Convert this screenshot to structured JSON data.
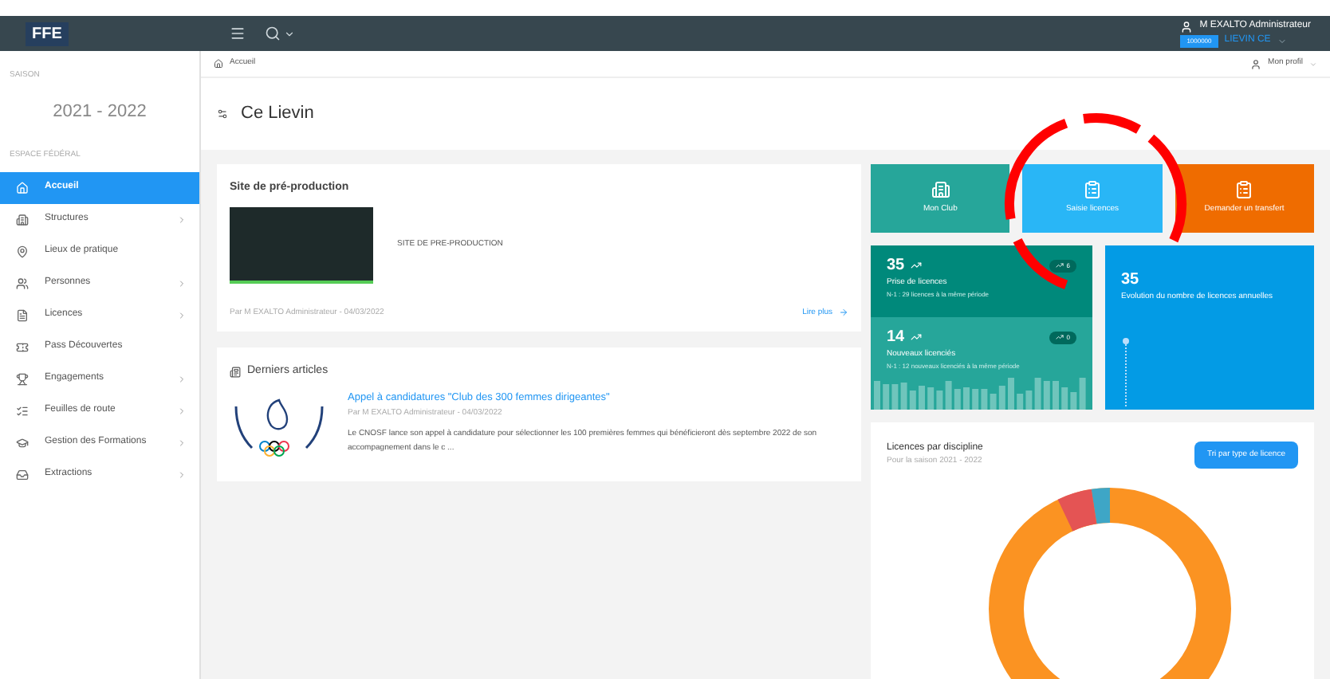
{
  "header": {
    "logo": "FFE",
    "user": "M EXALTO Administrateur",
    "badge": "1000000",
    "club": "LIEVIN CE"
  },
  "sidebar": {
    "season_label": "SAISON",
    "season": "2021 - 2022",
    "section": "ESPACE FÉDÉRAL",
    "items": [
      {
        "label": "Accueil",
        "selected": true,
        "expandable": false
      },
      {
        "label": "Structures",
        "selected": false,
        "expandable": true
      },
      {
        "label": "Lieux de pratique",
        "selected": false,
        "expandable": false
      },
      {
        "label": "Personnes",
        "selected": false,
        "expandable": true
      },
      {
        "label": "Licences",
        "selected": false,
        "expandable": true
      },
      {
        "label": "Pass Découvertes",
        "selected": false,
        "expandable": false
      },
      {
        "label": "Engagements",
        "selected": false,
        "expandable": true
      },
      {
        "label": "Feuilles de route",
        "selected": false,
        "expandable": true
      },
      {
        "label": "Gestion des Formations",
        "selected": false,
        "expandable": true
      },
      {
        "label": "Extractions",
        "selected": false,
        "expandable": true
      }
    ]
  },
  "breadcrumb": "Accueil",
  "profile": "Mon profil",
  "page_title": "Ce Lievin",
  "news": {
    "title": "Site de pré-production",
    "text": "SITE DE PRE-PRODUCTION",
    "meta": "Par M EXALTO Administrateur - 04/03/2022",
    "link": "Lire plus"
  },
  "articles": {
    "title": "Derniers articles",
    "items": [
      {
        "title": "Appel à candidatures \"Club des 300 femmes dirigeantes\"",
        "meta": "Par M EXALTO Administrateur - 04/03/2022",
        "summary": "Le CNOSF lance son appel à candidature pour sélectionner les 100 premières femmes qui bénéficieront dès septembre 2022 de son accompagnement dans le c ..."
      }
    ]
  },
  "tiles": [
    {
      "label": "Mon Club",
      "color": "#26a69a"
    },
    {
      "label": "Saisie licences",
      "color": "#29b6f6"
    },
    {
      "label": "Demander un transfert",
      "color": "#ef6c00"
    }
  ],
  "stats": [
    {
      "value": "35",
      "label": "Prise de licences",
      "detail": "N-1 : 29 licences à la même période",
      "delta": "6"
    },
    {
      "value": "14",
      "label": "Nouveaux licenciés",
      "detail": "N-1 : 12 nouveaux licenciés à la même période",
      "delta": "0"
    }
  ],
  "evolution": {
    "value": "35",
    "label": "Evolution du nombre de licences annuelles"
  },
  "discipline": {
    "title": "Licences par discipline",
    "subtitle": "Pour la saison 2021 - 2022",
    "button": "Tri par type de licence"
  }
}
